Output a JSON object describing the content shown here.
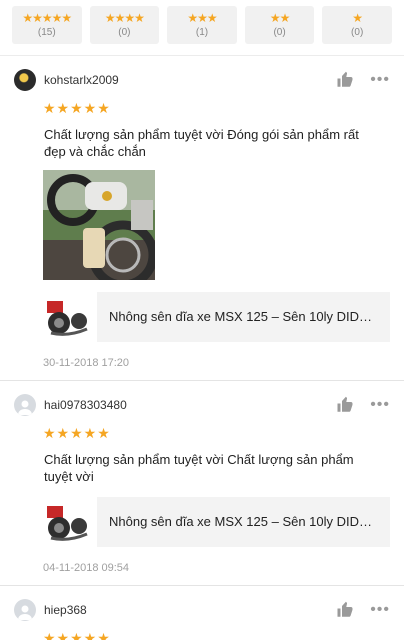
{
  "rating_filters": [
    {
      "stars": "★★★★★",
      "count": "(15)"
    },
    {
      "stars": "★★★★",
      "count": "(0)"
    },
    {
      "stars": "★★★",
      "count": "(1)"
    },
    {
      "stars": "★★",
      "count": "(0)"
    },
    {
      "stars": "★",
      "count": "(0)"
    }
  ],
  "icons": {
    "like": "thumbs-up-icon",
    "more": "more-options-icon",
    "avatar_default": "user-icon"
  },
  "colors": {
    "star": "#f5a623",
    "icon_gray": "#9a9a9a"
  },
  "reviews": [
    {
      "username": "kohstarlx2009",
      "stars": "★★★★★",
      "text": "Chất lượng sản phẩm tuyệt vời Đóng gói sản phẩm rất đẹp và chắc chắn",
      "product": "Nhông sên dĩa xe MSX 125 – Sên 10ly DID…",
      "timestamp": "30-11-2018 17:20"
    },
    {
      "username": "hai0978303480",
      "stars": "★★★★★",
      "text": "Chất lượng sản phẩm tuyệt vời Chất lượng sản phẩm tuyệt vời",
      "product": "Nhông sên dĩa xe MSX 125 – Sên 10ly DID…",
      "timestamp": "04-11-2018 09:54"
    },
    {
      "username": "hiep368",
      "stars": "★★★★★"
    }
  ]
}
